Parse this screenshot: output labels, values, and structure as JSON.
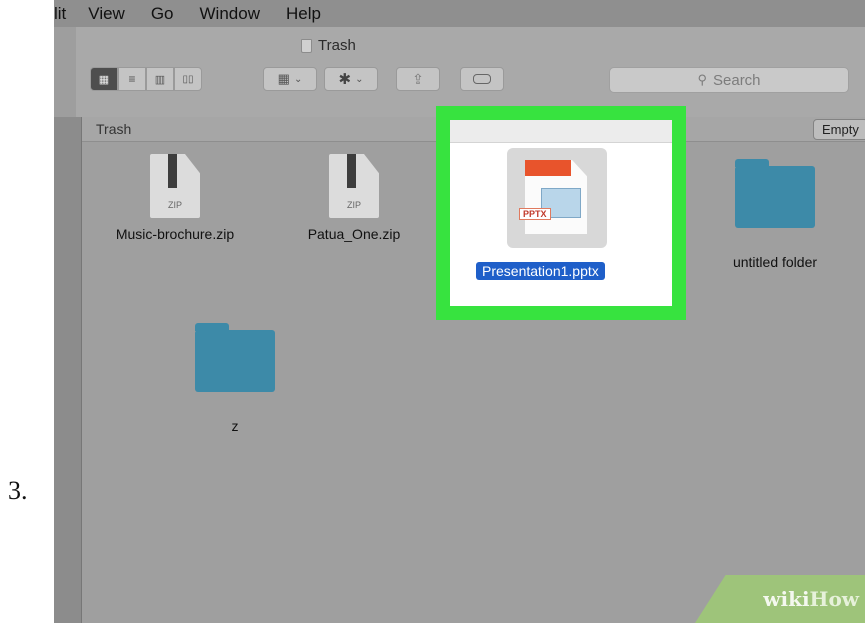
{
  "step_number": "3.",
  "menubar": {
    "items": [
      "lit",
      "View",
      "Go",
      "Window",
      "Help"
    ]
  },
  "window": {
    "title": "Trash"
  },
  "toolbar": {
    "view_buttons": [
      "icon-view",
      "list-view",
      "column-view",
      "coverflow-view"
    ],
    "arrange_icon": "arrange-icon",
    "action_icon": "gear-icon",
    "share_icon": "share-icon",
    "tag_icon": "tag-icon",
    "search_placeholder": "Search"
  },
  "pathbar": {
    "label": "Trash",
    "empty_button": "Empty"
  },
  "files": [
    {
      "name": "Music-brochure.zip",
      "kind": "zip",
      "badge": "ZIP"
    },
    {
      "name": "Patua_One.zip",
      "kind": "zip",
      "badge": "ZIP"
    },
    {
      "name": "Presentation1.pptx",
      "kind": "pptx",
      "badge": "PPTX",
      "selected": true
    },
    {
      "name": "untitled folder",
      "kind": "folder"
    },
    {
      "name": "z",
      "kind": "folder"
    }
  ],
  "highlight_color": "#37e33f",
  "selection_color": "#1f5fc9",
  "watermark": {
    "part1": "wiki",
    "part2": "How"
  }
}
